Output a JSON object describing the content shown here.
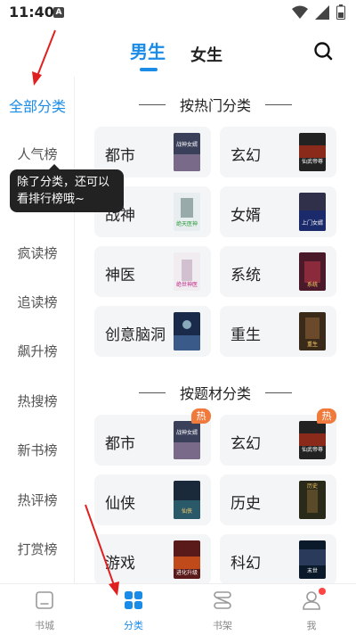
{
  "status_bar": {
    "time": "11:40",
    "notif_letter": "A"
  },
  "header": {
    "tab_male": "男生",
    "tab_female": "女生"
  },
  "sidebar": {
    "items": [
      "全部分类",
      "人气榜",
      "疯读榜",
      "追读榜",
      "飙升榜",
      "热搜榜",
      "新书榜",
      "热评榜",
      "打赏榜"
    ]
  },
  "tooltip": {
    "text": "除了分类，还可以看排行榜哦~"
  },
  "sections": [
    {
      "title": "按热门分类",
      "cards": [
        {
          "label": "都市",
          "cover_text": "战神女婿",
          "hot": false
        },
        {
          "label": "玄幻",
          "cover_text": "仙武帝尊",
          "hot": false
        },
        {
          "label": "战神",
          "cover_text": "绝天医神",
          "hot": false
        },
        {
          "label": "女婿",
          "cover_text": "上门女婿",
          "hot": false
        },
        {
          "label": "神医",
          "cover_text": "绝世神医",
          "hot": false
        },
        {
          "label": "系统",
          "cover_text": "系统",
          "hot": false
        },
        {
          "label": "创意脑洞",
          "cover_text": "",
          "hot": false
        },
        {
          "label": "重生",
          "cover_text": "重生",
          "hot": false
        }
      ]
    },
    {
      "title": "按题材分类",
      "cards": [
        {
          "label": "都市",
          "cover_text": "战神女婿",
          "hot": true
        },
        {
          "label": "玄幻",
          "cover_text": "仙武帝尊",
          "hot": true
        },
        {
          "label": "仙侠",
          "cover_text": "仙侠",
          "hot": false
        },
        {
          "label": "历史",
          "cover_text": "历史",
          "hot": false
        },
        {
          "label": "游戏",
          "cover_text": "进化升级",
          "hot": false
        },
        {
          "label": "科幻",
          "cover_text": "末世",
          "hot": false
        }
      ]
    }
  ],
  "hot_badge": "热",
  "bottom_nav": [
    {
      "label": "书城",
      "icon": "bookstore-icon"
    },
    {
      "label": "分类",
      "icon": "category-grid-icon"
    },
    {
      "label": "书架",
      "icon": "bookshelf-icon"
    },
    {
      "label": "我",
      "icon": "profile-icon"
    }
  ],
  "colors": {
    "accent": "#1a8ce8",
    "hot": "#f07a3c",
    "annotation": "#e02020"
  }
}
